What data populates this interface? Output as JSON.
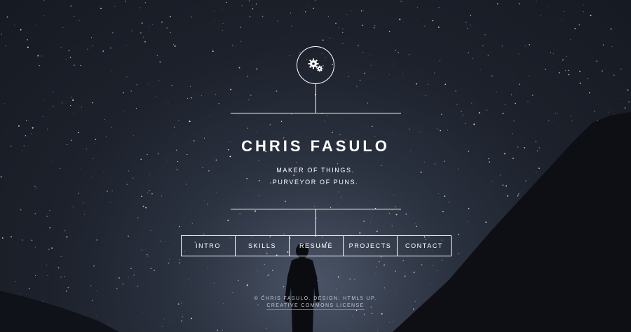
{
  "header": {
    "logo_icon": "gears-icon",
    "name": "CHRIS FASULO",
    "tagline_line1": "MAKER OF THINGS.",
    "tagline_line2": "PURVEYOR OF PUNS."
  },
  "nav": {
    "items": [
      {
        "label": "INTRO"
      },
      {
        "label": "SKILLS"
      },
      {
        "label": "RESUMÉ"
      },
      {
        "label": "PROJECTS"
      },
      {
        "label": "CONTACT"
      }
    ]
  },
  "footer": {
    "copyright": "© CHRIS FASULO. DESIGN: HTML5 UP.",
    "license": "CREATIVE COMMONS LICENSE"
  },
  "colors": {
    "text": "#ffffff",
    "sky_dark": "#161a22",
    "sky_light": "#4a5466",
    "silhouette": "#0d0f14"
  }
}
